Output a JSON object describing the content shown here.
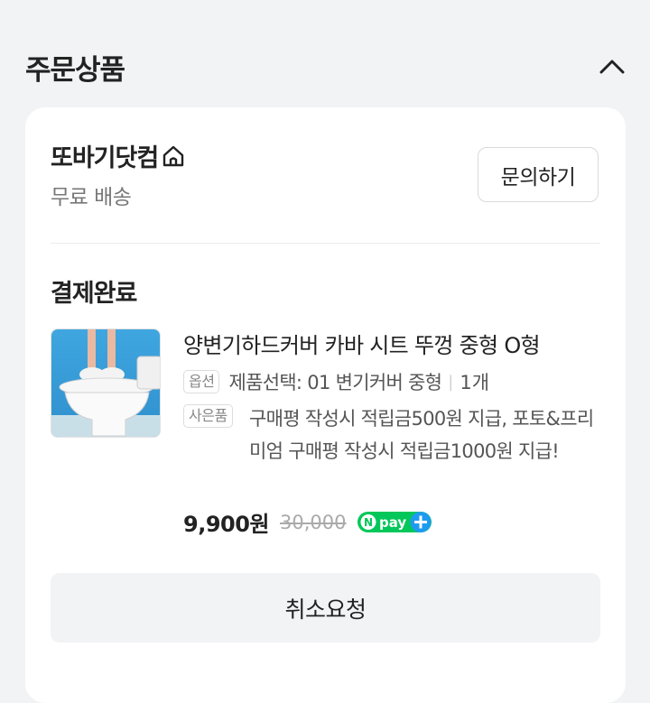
{
  "section": {
    "title": "주문상품",
    "collapse_icon": "chevron-up-icon"
  },
  "store": {
    "name": "또바기닷컴",
    "home_icon": "home-icon",
    "shipping": "무료 배송",
    "inquiry_label": "문의하기"
  },
  "order": {
    "status": "결제완료",
    "product": {
      "name": "양변기하드커버 카바 시트 뚜껑 중형 O형",
      "option_tag": "옵션",
      "option_text": "제품선택: 01 변기커버 중형",
      "quantity": "1개",
      "gift_tag": "사은품",
      "gift_text": "구매평 작성시 적립금500원 지급, 포토&프리미엄 구매평 작성시 적립금1000원 지급!",
      "price": "9,900원",
      "original_price": "30,000",
      "badge": "N pay +"
    },
    "cancel_label": "취소요청"
  },
  "colors": {
    "npay_green": "#03c75a",
    "npay_blue": "#1e9bf0",
    "background": "#f2f3f5"
  }
}
